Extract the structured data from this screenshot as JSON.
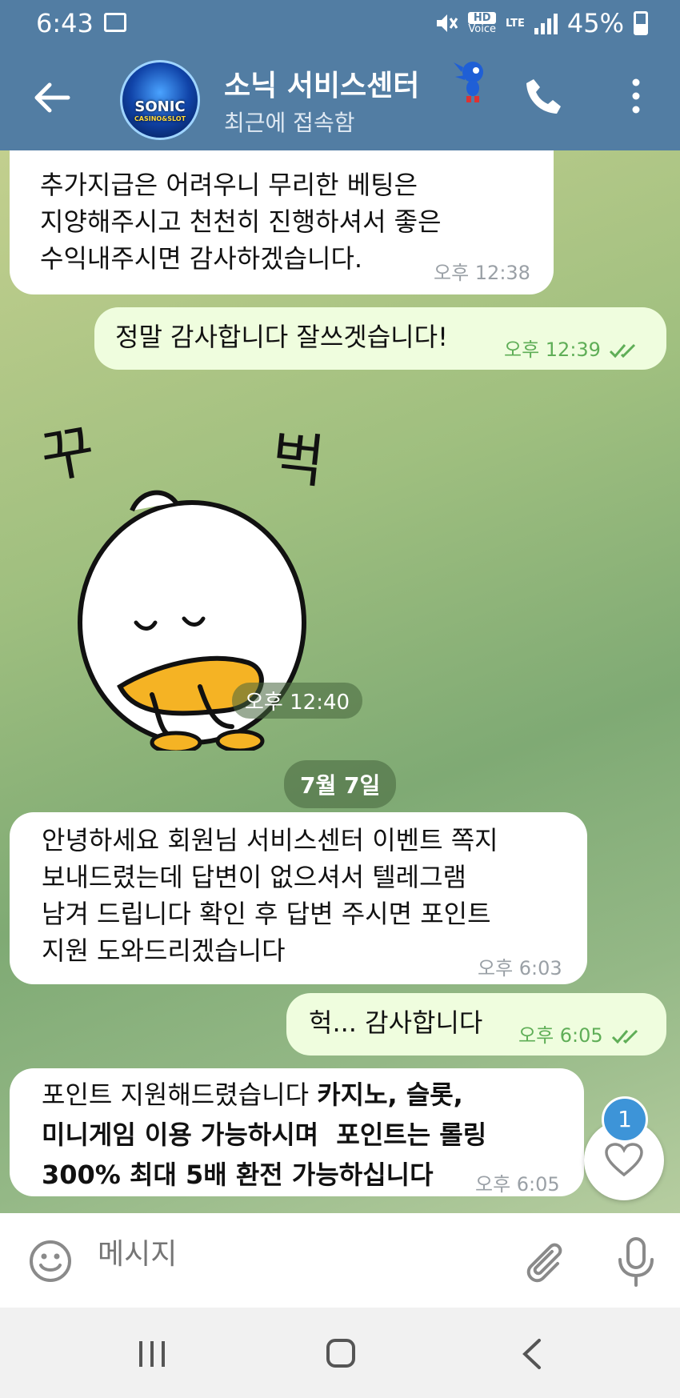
{
  "status_bar": {
    "time": "6:43",
    "battery": "45%",
    "hd_label": "HD",
    "voice_label": "Voice",
    "lte_label": "LTE"
  },
  "header": {
    "title": "소닉 서비스센터",
    "subtitle": "최근에 접속함",
    "avatar_logo": "SONIC",
    "avatar_logo_sub": "CASINO&SLOT"
  },
  "messages": [
    {
      "direction": "in",
      "text": "추가지급은 어려우니 무리한 베팅은\n지양해주시고 천천히 진행하셔서 좋은\n수익내주시면 감사하겠습니다.",
      "time": "오후 12:38"
    },
    {
      "direction": "out",
      "text": "정말 감사합니다 잘쓰겟습니다!",
      "time": "오후 12:39",
      "read": true
    },
    {
      "direction": "in",
      "type": "sticker",
      "sticker_text_left": "꾸",
      "sticker_text_right": "벅",
      "time": "오후 12:40"
    },
    {
      "type": "date",
      "text": "7월 7일"
    },
    {
      "direction": "in",
      "text": "안녕하세요 회원님 서비스센터 이벤트 쪽지\n보내드렸는데 답변이 없으셔서 텔레그램\n남겨 드립니다 확인 후 답변 주시면 포인트\n지원 도와드리겠습니다",
      "time": "오후 6:03"
    },
    {
      "direction": "out",
      "text": "헉... 감사합니다",
      "time": "오후 6:05",
      "read": true
    },
    {
      "direction": "in",
      "text_plain": "포인트 지원해드렸습니다 ",
      "text_bold_1": "카지노, 슬롯,",
      "text_bold_2": "미니게임 이용 가능하시며  포인트는 롤링",
      "text_bold_3": "300% 최대 5배 환전 가능하십니다",
      "time": "오후 6:05"
    }
  ],
  "reaction": {
    "count": "1",
    "icon": "heart-icon"
  },
  "composer": {
    "placeholder": "메시지"
  },
  "colors": {
    "header": "#527da3",
    "incoming": "#ffffff",
    "outgoing": "#effdde",
    "time_out": "#5fae57",
    "badge": "#3d94d8"
  }
}
